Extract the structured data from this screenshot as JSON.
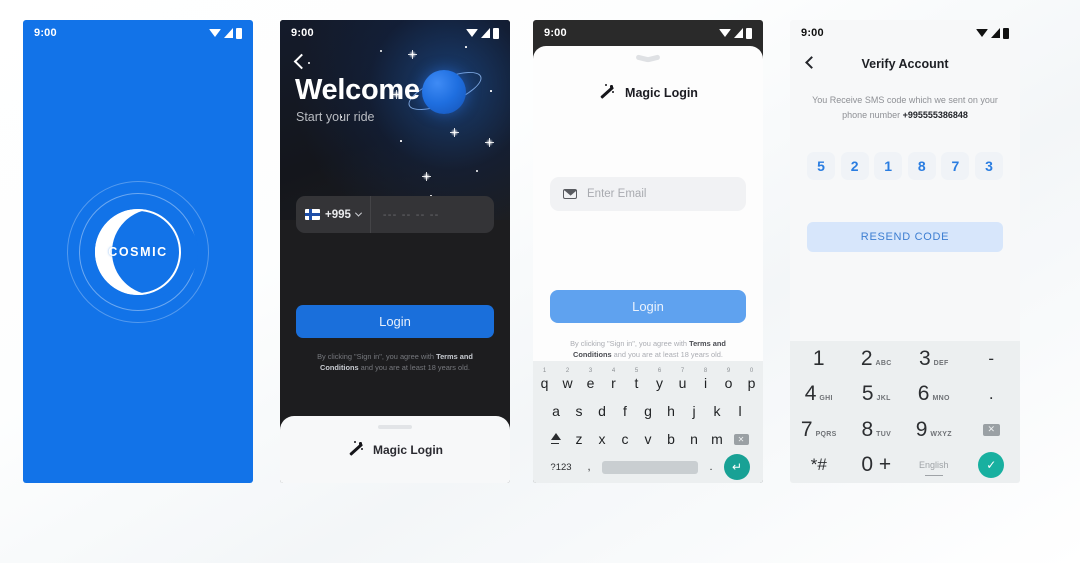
{
  "status_bar": {
    "time": "9:00",
    "icons": [
      "wifi-icon",
      "signal-icon",
      "battery-icon"
    ]
  },
  "screen_splash": {
    "brand": "COSMIC",
    "background_color": "#1273e8"
  },
  "screen_welcome": {
    "back_icon": "back-chevron-icon",
    "title": "Welcome",
    "subtitle": "Start your ride",
    "country_code": "+995",
    "country_flag": "finland-flag-icon",
    "phone_placeholder": "--- -- -- --",
    "login_label": "Login",
    "terms_prefix": "By clicking \"Sign in\", you agree with ",
    "terms_link": "Terms and Conditions",
    "terms_suffix": " and you are at least 18 years old.",
    "magic_login_label": "Magic Login",
    "accent_color": "#1a6fdb"
  },
  "screen_magic_login": {
    "title": "Magic Login",
    "email_placeholder": "Enter Email",
    "login_label": "Login",
    "terms_prefix": "By clicking \"Sign in\", you agree with ",
    "terms_link": "Terms and Conditions",
    "terms_suffix": " and you are at least 18 years old.",
    "accent_color": "#5fa2ef",
    "keyboard": {
      "row1": [
        {
          "key": "q",
          "sup": "1"
        },
        {
          "key": "w",
          "sup": "2"
        },
        {
          "key": "e",
          "sup": "3"
        },
        {
          "key": "r",
          "sup": "4"
        },
        {
          "key": "t",
          "sup": "5"
        },
        {
          "key": "y",
          "sup": "6"
        },
        {
          "key": "u",
          "sup": "7"
        },
        {
          "key": "i",
          "sup": "8"
        },
        {
          "key": "o",
          "sup": "9"
        },
        {
          "key": "p",
          "sup": "0"
        }
      ],
      "row2": [
        "a",
        "s",
        "d",
        "f",
        "g",
        "h",
        "j",
        "k",
        "l"
      ],
      "row3": [
        "z",
        "x",
        "c",
        "v",
        "b",
        "n",
        "m"
      ],
      "numbers_key": "?123",
      "comma_key": ",",
      "period_key": ".",
      "enter_icon": "enter-icon",
      "shift_icon": "shift-icon",
      "backspace_icon": "backspace-icon"
    }
  },
  "screen_verify": {
    "back_icon": "back-chevron-icon",
    "title": "Verify Account",
    "description_prefix": "You Receive SMS code which we sent on your phone number ",
    "phone_number": "+995555386848",
    "otp_digits": [
      "5",
      "2",
      "1",
      "8",
      "7",
      "3"
    ],
    "resend_label": "RESEND CODE",
    "otp_color": "#2a7de1",
    "resend_bg": "#d7e6fb",
    "numpad": [
      {
        "num": "1",
        "sub": ""
      },
      {
        "num": "2",
        "sub": "ABC"
      },
      {
        "num": "3",
        "sub": "DEF"
      },
      {
        "num": "-",
        "sub": ""
      },
      {
        "num": "4",
        "sub": "GHI"
      },
      {
        "num": "5",
        "sub": "JKL"
      },
      {
        "num": "6",
        "sub": "MNO"
      },
      {
        "num": ".",
        "sub": ""
      },
      {
        "num": "7",
        "sub": "PQRS"
      },
      {
        "num": "8",
        "sub": "TUV"
      },
      {
        "num": "9",
        "sub": "WXYZ"
      },
      {
        "num": "del",
        "sub": ""
      },
      {
        "num": "*#",
        "sub": ""
      },
      {
        "num": "0 +",
        "sub": ""
      },
      {
        "num": "English",
        "sub": ""
      },
      {
        "num": "ok",
        "sub": ""
      }
    ]
  }
}
